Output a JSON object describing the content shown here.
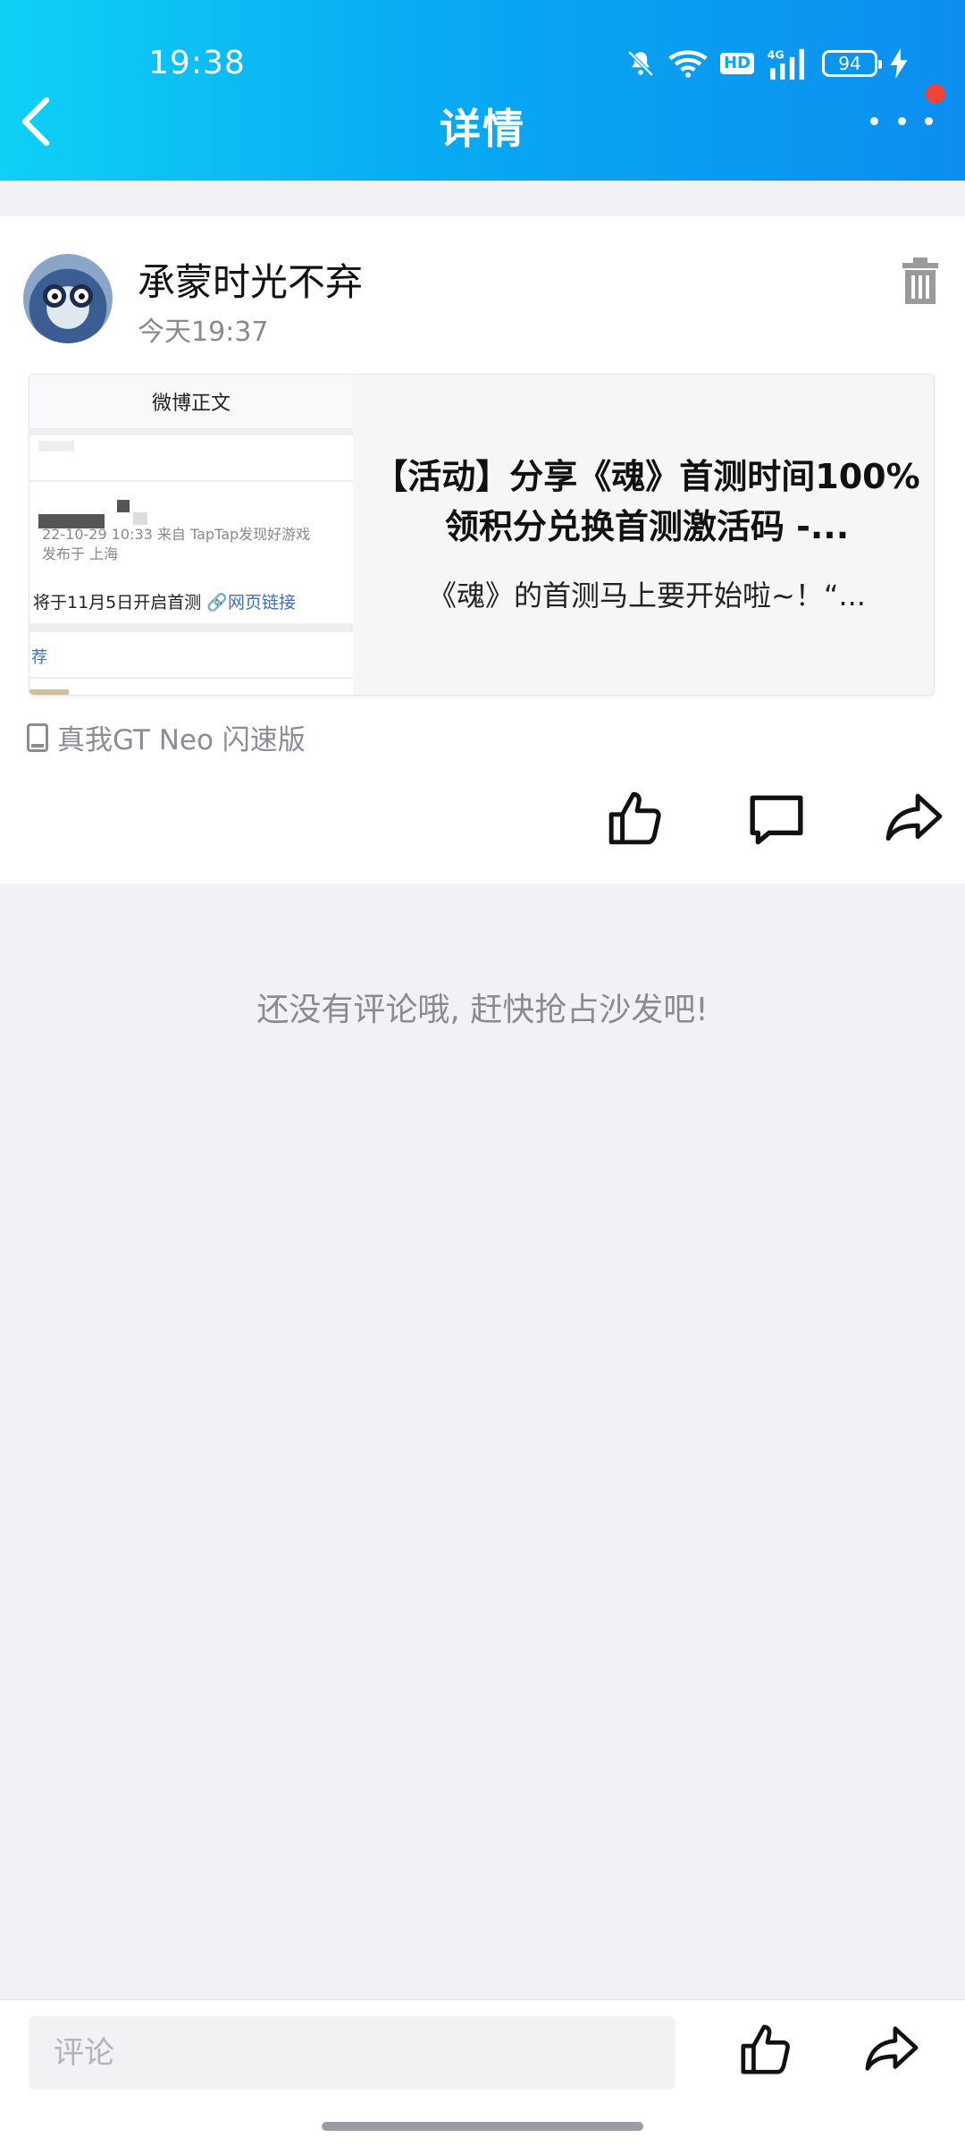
{
  "status_bar": {
    "time": "19:38",
    "battery": "94",
    "network": "4G",
    "hd": "HD"
  },
  "nav": {
    "title": "详情"
  },
  "post": {
    "author": "承蒙时光不弃",
    "time": "今天19:37",
    "link_card": {
      "thumb_title": "微博正文",
      "thumb_meta_line1": "22-10-29 10:33  来自 TapTap发现好游戏",
      "thumb_meta_line2": "发布于 上海",
      "thumb_text": "将于11月5日开启首测",
      "thumb_link": "网页链接",
      "thumb_rec": "荐",
      "title": "【活动】分享《魂》首测时间100%领积分兑换首测激活码 -...",
      "description": "《魂》的首测马上要开始啦~！“..."
    },
    "device": "真我GT Neo 闪速版"
  },
  "comments": {
    "empty_text": "还没有评论哦, 赶快抢占沙发吧!"
  },
  "bottom_bar": {
    "comment_placeholder": "评论"
  },
  "colors": {
    "header_start": "#0fd0f6",
    "header_end": "#0c8ef0",
    "notification_dot": "#f44336"
  }
}
